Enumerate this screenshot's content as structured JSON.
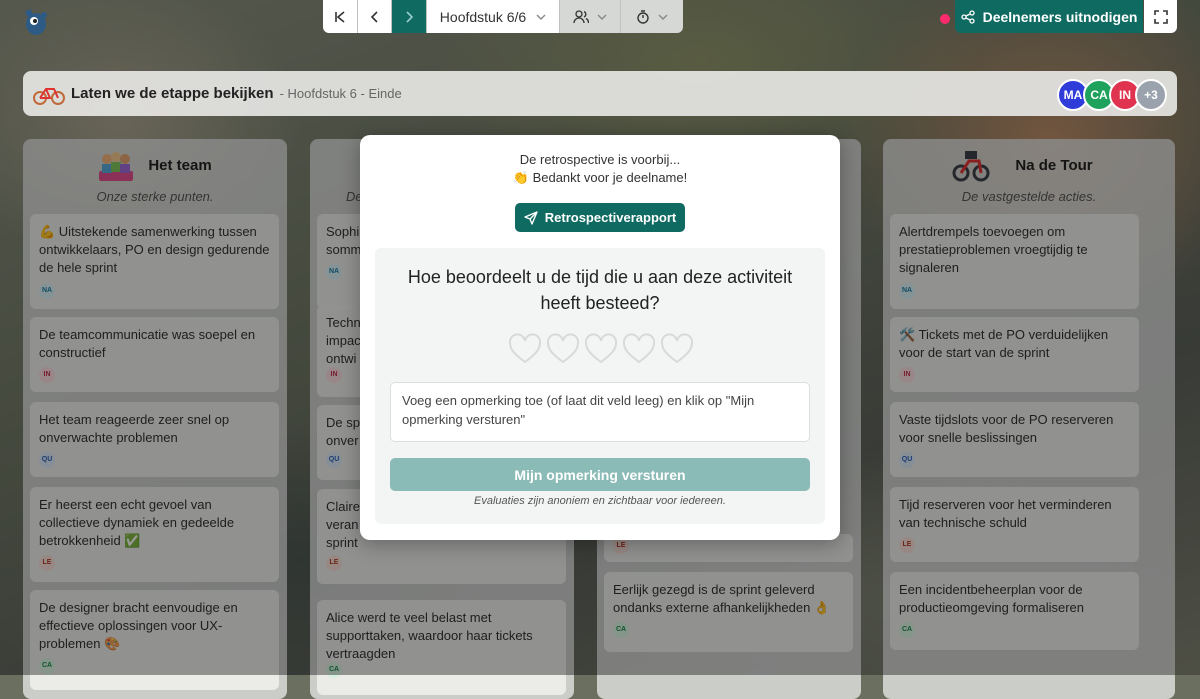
{
  "toolbar": {
    "chapter_label": "Hoofdstuk 6/6",
    "invite_label": "Deelnemers uitnodigen"
  },
  "stage": {
    "title": "Laten we de etappe bekijken",
    "subtitle": "- Hoofdstuk 6 - Einde",
    "avatars": [
      {
        "initials": "MA",
        "color": "#2f3cd9"
      },
      {
        "initials": "CA",
        "color": "#1fa35c"
      },
      {
        "initials": "IN",
        "color": "#e0334f"
      }
    ],
    "more_count": "+3"
  },
  "columns": [
    {
      "title": "Het team",
      "desc": "Onze sterke punten.",
      "cards": [
        {
          "text": "💪 Uitstekende samenwerking tussen ontwikkelaars, PO en design gedurende de hele sprint",
          "author": "NA"
        },
        {
          "text": "De teamcommunicatie was soepel en constructief",
          "author": "IN"
        },
        {
          "text": "Het team reageerde zeer snel op onverwachte problemen",
          "author": "QU"
        },
        {
          "text": "Er heerst een echt gevoel van collectieve dynamiek en gedeelde betrokkenheid ✅",
          "author": "LE"
        },
        {
          "text": "De designer bracht eenvoudige en effectieve oplossingen voor UX-problemen 🎨",
          "author": "CA"
        }
      ]
    },
    {
      "title": "",
      "desc": "De",
      "cards": [
        {
          "text": "Sophi somm",
          "author": "NA"
        },
        {
          "text": "Techn impac ontwi",
          "author": "IN"
        },
        {
          "text": "De sp onver",
          "author": "QU"
        },
        {
          "text": "Claire veran sprint",
          "author": "LE"
        },
        {
          "text": "Alice werd te veel belast met supporttaken, waardoor haar tickets vertraagden",
          "author": "CA"
        }
      ]
    },
    {
      "title": "",
      "desc": "",
      "cards": [
        {
          "text": "",
          "author": "LE"
        },
        {
          "text": "Eerlijk gezegd is de sprint geleverd ondanks externe afhankelijkheden 👌",
          "author": "CA"
        }
      ]
    },
    {
      "title": "Na de Tour",
      "desc": "De vastgestelde acties.",
      "cards": [
        {
          "text": "Alertdrempels toevoegen om prestatieproblemen vroegtijdig te signaleren",
          "author": "NA"
        },
        {
          "text": "🛠️ Tickets met de PO verduidelijken voor de start van de sprint",
          "author": "IN"
        },
        {
          "text": "Vaste tijdslots voor de PO reserveren voor snelle beslissingen",
          "author": "QU"
        },
        {
          "text": "Tijd reserveren voor het verminderen van technische schuld",
          "author": "LE"
        },
        {
          "text": "Een incidentbeheerplan voor de productieomgeving formaliseren",
          "author": "CA"
        }
      ]
    }
  ],
  "modal": {
    "over_text": "De retrospective is voorbij...",
    "thanks_text": "👏 Bedankt voor je deelname!",
    "report_button": "Retrospectiverapport",
    "question": "Hoe beoordeelt u de tijd die u aan deze activiteit heeft besteed?",
    "rating": 0,
    "rating_max": 5,
    "comment_placeholder": "Voeg een opmerking toe (of laat dit veld leeg) en klik op \"Mijn opmerking versturen\"",
    "comment_value": "",
    "send_button": "Mijn opmerking versturen",
    "anon_note": "Evaluaties zijn anoniem en zichtbaar voor iedereen."
  },
  "colors": {
    "primary": "#0f6a61",
    "send_disabled": "#8bbbb6",
    "accent_pink": "#ff2a6d"
  },
  "icons": [
    "logo-icon",
    "first-icon",
    "prev-icon",
    "next-icon",
    "chevron-down-icon",
    "users-icon",
    "timer-icon",
    "share-icon",
    "fullscreen-icon",
    "bike-icon",
    "team-icon",
    "podium-icon",
    "send-icon",
    "heart-icon"
  ]
}
